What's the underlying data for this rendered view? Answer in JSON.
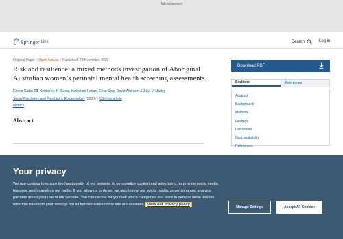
{
  "ad": {
    "label": "Advertisement"
  },
  "header": {
    "logo_text": "Springer",
    "logo_sub": "Link",
    "search_label": "Search",
    "login_label": "Log in"
  },
  "article": {
    "type": "Original Paper",
    "access": "Open Access",
    "published": "Published: 23 November 2020",
    "title": "Risk and resilience: a mixed methods investigation of Aboriginal Australian women’s perinatal mental health screening assessments",
    "authors": [
      "Emma Carlin",
      "Kimberley H. Seear",
      "Katherine Ferrari",
      "Erica Spry",
      "David Atkinson"
    ],
    "author_last": "Julia V. Marley",
    "author_and": "&",
    "journal": "Social Psychiatry and Psychiatric Epidemiology",
    "year": "(2020)",
    "cite": "Cite this article",
    "metrics": "Metrics",
    "abstract_heading": "Abstract"
  },
  "sidebar": {
    "download_label": "Download PDF",
    "tabs": [
      {
        "label": "Sections"
      },
      {
        "label": "References"
      }
    ],
    "sections": [
      "Abstract",
      "Background",
      "Methods",
      "Findings",
      "Discussion",
      "Data availability",
      "References"
    ]
  },
  "cookie": {
    "title": "Your privacy",
    "text": "We use cookies to ensure the functionality of our website, to personalize content and advertising, to provide social media features, and to analyze our traffic. If you allow us to do so, we also inform our social media, advertising and analysis partners about your use of our website. You can decide for yourself which categories you want to deny or allow. Please note that based on your settings not all functionalities of the site are available.",
    "policy_link": "View our privacy policy",
    "manage_label": "Manage Settings",
    "accept_label": "Accept All Cookies"
  },
  "colors": {
    "brand": "#245b8e",
    "link": "#0a5fa3",
    "open_access": "#c65301",
    "cookie_bg": "#3d5a73"
  }
}
